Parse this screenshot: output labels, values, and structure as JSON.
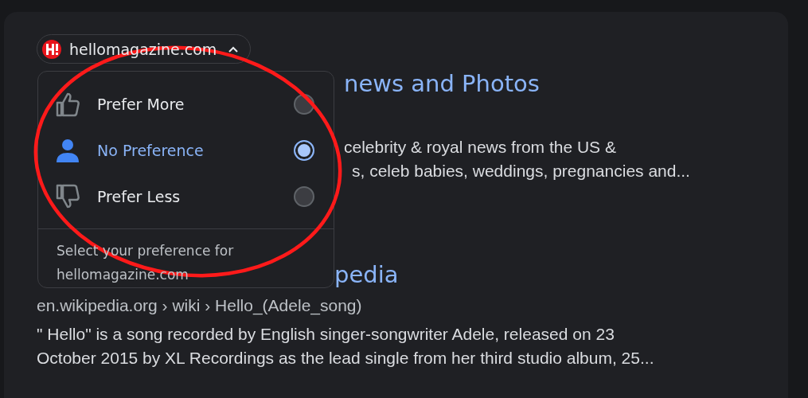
{
  "source_chip": {
    "domain": "hellomagazine.com",
    "expanded": true
  },
  "results": [
    {
      "title": "news and Photos",
      "snippet_lines": [
        "celebrity & royal news from the US &",
        "s, celeb babies, weddings, pregnancies and..."
      ]
    },
    {
      "title": "pedia",
      "url": "en.wikipedia.org › wiki › Hello_(Adele_song)",
      "snippet_lines": [
        "\" Hello\" is a song recorded by English singer-songwriter Adele, released on 23",
        "October 2015 by XL Recordings as the lead single from her third studio album, 25..."
      ]
    }
  ],
  "preference_menu": {
    "options": [
      {
        "kind": "thumb-up",
        "label": "Prefer More",
        "selected": false
      },
      {
        "kind": "person",
        "label": "No Preference",
        "selected": true
      },
      {
        "kind": "thumb-down",
        "label": "Prefer Less",
        "selected": false
      }
    ],
    "footer": "Select your preference for hellomagazine.com"
  },
  "annotation": {
    "kind": "ellipse",
    "color": "#ff1a1a"
  }
}
